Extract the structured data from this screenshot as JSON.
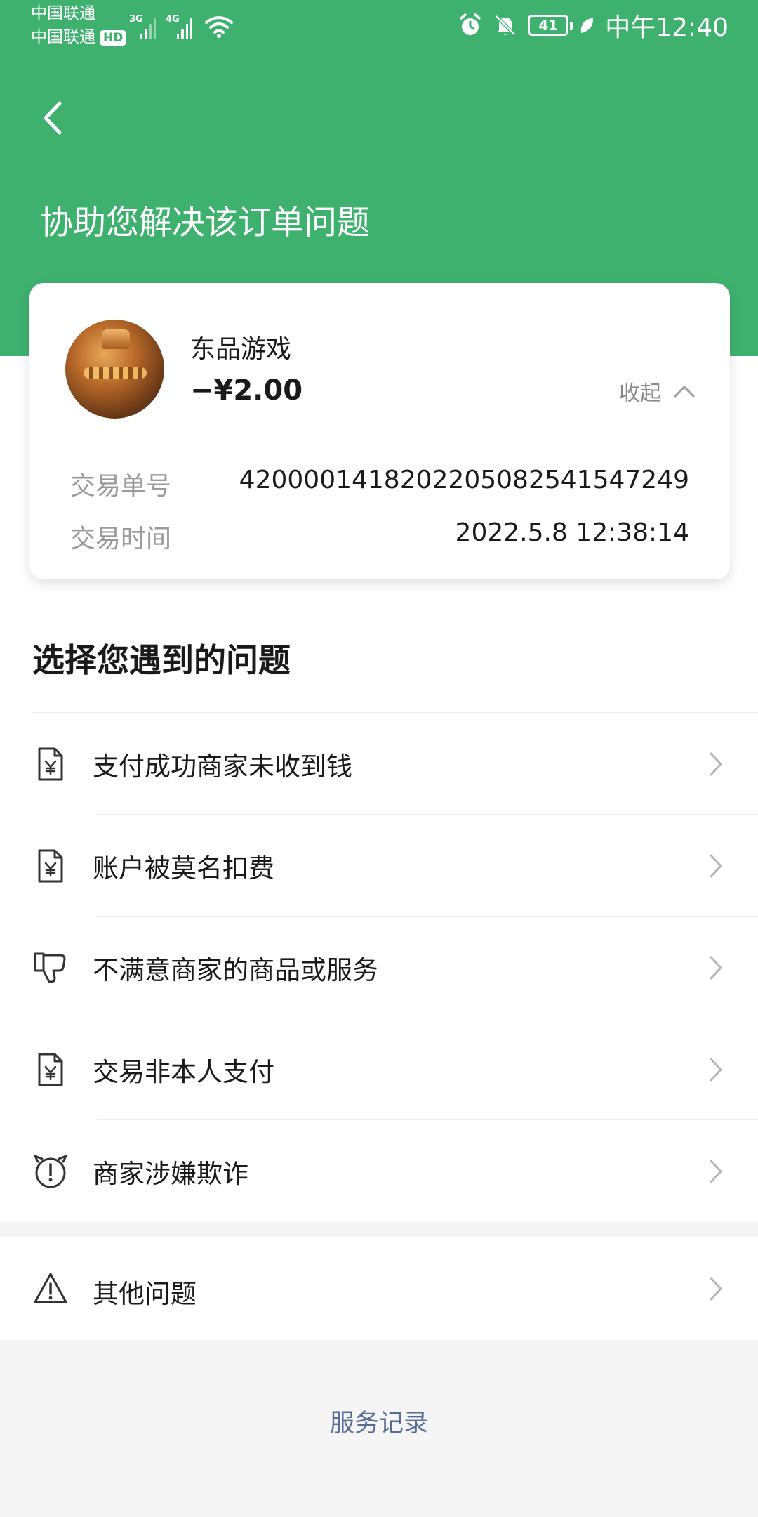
{
  "status_bar": {
    "carrier_1": "中国联通",
    "carrier_2": "中国联通",
    "hd_badge": "HD",
    "signal_1_label": "3G",
    "signal_2_label": "4G",
    "battery_level": "41",
    "time": "中午12:40"
  },
  "header": {
    "title": "协助您解决该订单问题",
    "bg_color": "#3fb16f"
  },
  "order": {
    "merchant_name": "东品游戏",
    "amount": "−¥2.00",
    "collapse_label": "收起",
    "details": [
      {
        "key": "交易单号",
        "value": "4200001418202205082541547249"
      },
      {
        "key": "交易时间",
        "value": "2022.5.8 12:38:14"
      }
    ]
  },
  "issues": {
    "section_title": "选择您遇到的问题",
    "items": [
      {
        "label": "支付成功商家未收到钱",
        "icon": "yuan-document-icon"
      },
      {
        "label": "账户被莫名扣费",
        "icon": "yuan-document-icon"
      },
      {
        "label": "不满意商家的商品或服务",
        "icon": "thumbs-down-icon"
      },
      {
        "label": "交易非本人支付",
        "icon": "yuan-document-icon"
      },
      {
        "label": "商家涉嫌欺诈",
        "icon": "fraud-alert-icon"
      }
    ],
    "other": {
      "label": "其他问题",
      "icon": "warning-triangle-icon"
    }
  },
  "footer": {
    "service_record": "服务记录",
    "link_color": "#566c96"
  }
}
